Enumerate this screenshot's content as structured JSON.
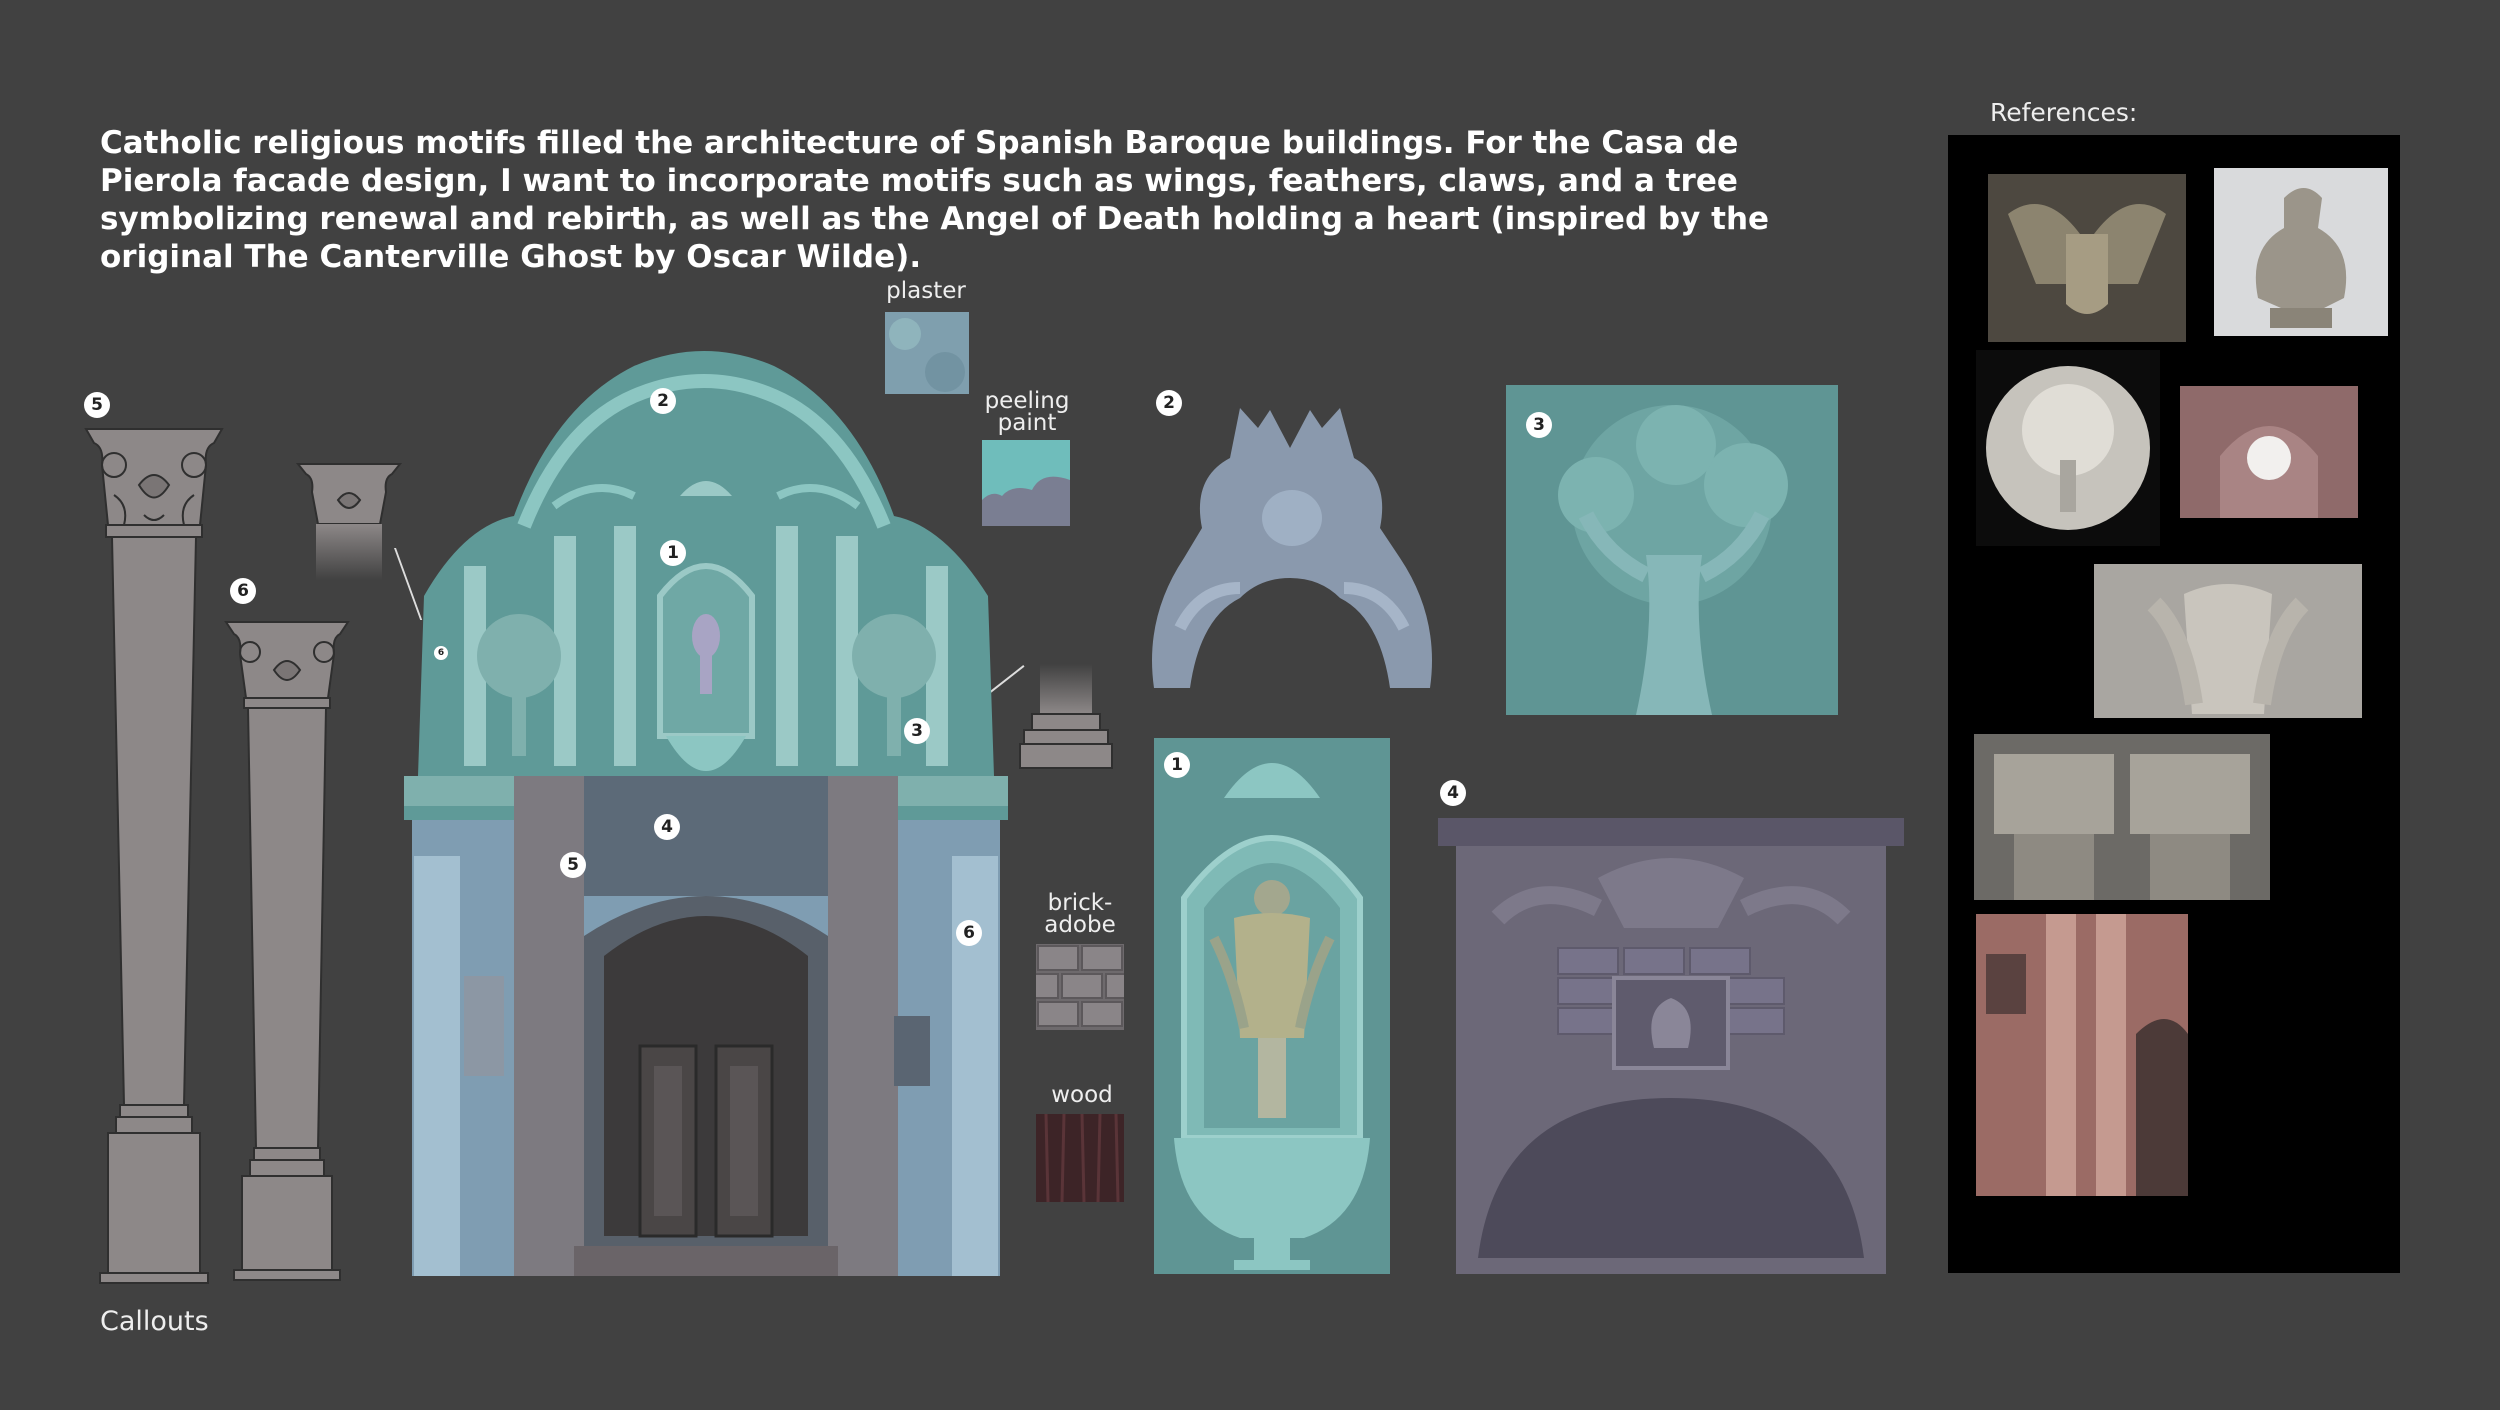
{
  "intro": {
    "text": "Catholic religious motifs filled the architecture of Spanish Baroque buildings. For the Casa de Pierola facade design, I want to incorporate motifs such as wings, feathers, claws, and a tree symbolizing renewal and rebirth, as well as the Angel of Death holding a heart (inspired by the original The Canterville Ghost by Oscar Wilde)."
  },
  "footer": {
    "callouts_label": "Callouts"
  },
  "references": {
    "label": "References:"
  },
  "materials": {
    "plaster": "plaster",
    "peeling_paint": "peeling paint",
    "brick_adobe": "brick-adobe",
    "wood": "wood"
  },
  "callout_numbers": {
    "one": "1",
    "two": "2",
    "three": "3",
    "four": "4",
    "five": "5",
    "six": "6"
  },
  "colors": {
    "background": "#414141",
    "teal": "#5f9a98",
    "light_teal": "#8cc6c2",
    "stone_blue": "#8aa6b8",
    "column_grey": "#8d8888",
    "reference_board": "#000000"
  }
}
